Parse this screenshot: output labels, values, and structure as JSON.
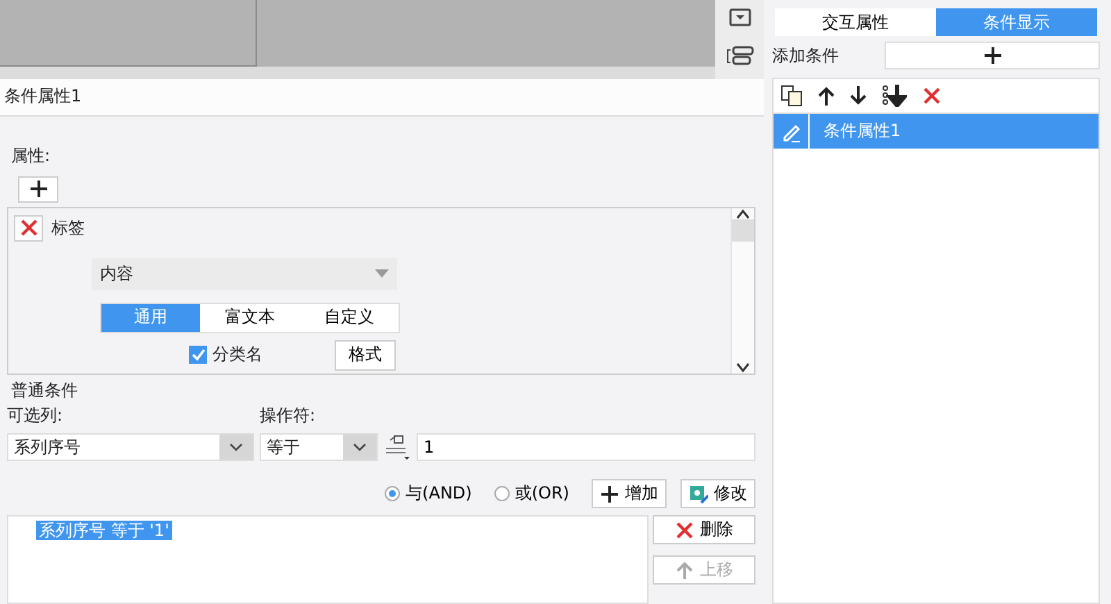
{
  "editor_title": "条件属性1",
  "attributes": {
    "legend": "属性:",
    "items": [
      {
        "label": "标签",
        "content_select": "内容",
        "tabs": [
          {
            "label": "通用",
            "selected": true
          },
          {
            "label": "富文本",
            "selected": false
          },
          {
            "label": "自定义",
            "selected": false
          }
        ],
        "checkbox": {
          "label": "分类名",
          "checked": true
        },
        "format_button": "格式"
      }
    ]
  },
  "common_condition": {
    "legend": "普通条件",
    "column_label": "可选列:",
    "column_value": "系列序号",
    "operator_label": "操作符:",
    "operator_value": "等于",
    "value": "1",
    "logic": [
      {
        "label": "与(AND)",
        "selected": true
      },
      {
        "label": "或(OR)",
        "selected": false
      }
    ],
    "buttons": [
      "增加",
      "修改"
    ],
    "conditions": [
      {
        "text": "系列序号 等于 '1'",
        "selected": true
      }
    ],
    "side_buttons": [
      {
        "label": "删除",
        "disabled": false
      },
      {
        "label": "上移",
        "disabled": true
      }
    ]
  },
  "tabs": [
    {
      "label": "交互属性",
      "selected": false
    },
    {
      "label": "条件显示",
      "selected": true
    }
  ],
  "add_condition": {
    "label": "添加条件"
  },
  "condition_list": [
    {
      "label": "条件属性1",
      "selected": true
    }
  ]
}
